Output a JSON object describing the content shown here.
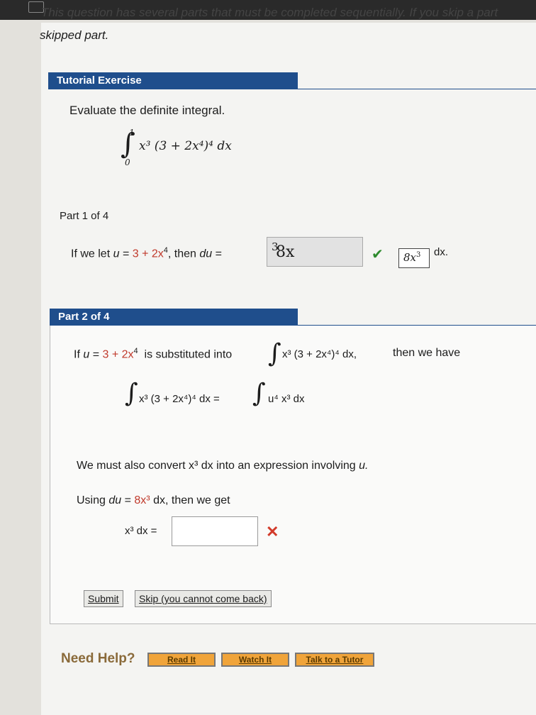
{
  "header": {
    "cut_instruction": "This question has several parts that must be completed sequentially. If you skip a part",
    "skipped_text": "skipped part."
  },
  "tutorial": {
    "title": "Tutorial Exercise",
    "prompt": "Evaluate the definite integral.",
    "integral_upper": "1",
    "integral_lower": "0",
    "integrand": "x³ (3 + 2x⁴)⁴ dx"
  },
  "part1": {
    "label": "Part 1 of 4",
    "sentence_a": "If we let",
    "u_var": "u",
    "eq": " = ",
    "u_expr": "3 + 2x",
    "u_exp": "4",
    "sentence_b": ", then",
    "du_var": "du",
    "answer_value": "8x",
    "answer_exp": "3",
    "correct_value": "8x",
    "correct_exp": "3",
    "dx_suffix": "dx."
  },
  "part2": {
    "label": "Part 2 of 4",
    "line1_a": "If",
    "line1_u": "u",
    "line1_expr": "3 + 2x",
    "line1_exp": "4",
    "line1_b": "is substituted into",
    "line1_integrand": "x³ (3 + 2x⁴)⁴ dx,",
    "line1_c": "then we have",
    "eq_left": "x³ (3 + 2x⁴)⁴ dx =",
    "eq_right": "u⁴ x³ dx",
    "convert_text": "We must also convert",
    "convert_expr": "x³ dx",
    "convert_rest": "into an expression involving",
    "convert_u": "u.",
    "using_a": "Using",
    "using_du": "du",
    "using_value": "8x³",
    "using_b": "dx, then we get",
    "result_label": "x³ dx =",
    "result_value": ""
  },
  "buttons": {
    "submit": "Submit",
    "skip": "Skip (you cannot come back)"
  },
  "help": {
    "title": "Need Help?",
    "read": "Read It",
    "watch": "Watch It",
    "tutor": "Talk to a Tutor"
  },
  "colors": {
    "header_blue": "#1f4e8c",
    "red_value": "#c0392b",
    "check_green": "#2e8b2e",
    "x_red": "#d23a2a"
  }
}
